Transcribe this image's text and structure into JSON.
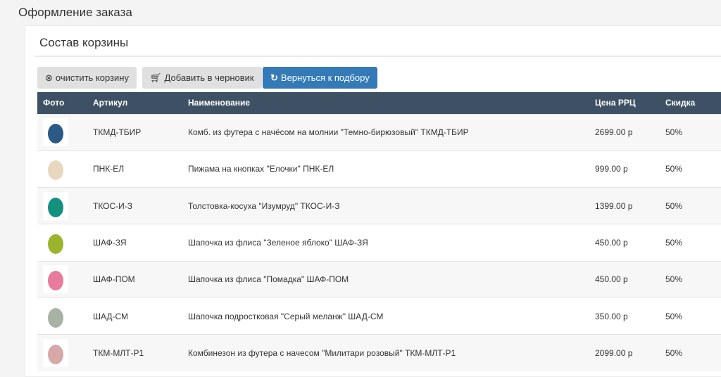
{
  "page_title": "Оформление заказа",
  "card_title": "Состав корзины",
  "buttons": {
    "clear": "очистить корзину",
    "draft": "Добавить в черновик",
    "back": "Вернуться к подбору"
  },
  "columns": [
    "Фото",
    "Артикул",
    "Наименование",
    "Цена РРЦ",
    "Скидка"
  ],
  "rows": [
    {
      "sku": "ТКМД-ТБИР",
      "name": "Комб. из футера с начёсом на молнии \"Темно-бирюзовый\" ТКМД-ТБИР",
      "price": "2699.00 р",
      "discount": "50%",
      "color": "#2a5a85"
    },
    {
      "sku": "ПНК-ЕЛ",
      "name": "Пижама на кнопках \"Елочки\" ПНК-ЕЛ",
      "price": "999.00 р",
      "discount": "50%",
      "color": "#e8d8c0"
    },
    {
      "sku": "ТКОС-И-З",
      "name": "Толстовка-косуха \"Изумруд\" ТКОС-И-З",
      "price": "1399.00 р",
      "discount": "50%",
      "color": "#14907f"
    },
    {
      "sku": "ШАФ-ЗЯ",
      "name": "Шапочка из флиса \"Зеленое яблоко\" ШАФ-ЗЯ",
      "price": "450.00 р",
      "discount": "50%",
      "color": "#9ab52c"
    },
    {
      "sku": "ШАФ-ПОМ",
      "name": "Шапочка из флиса \"Помадка\" ШАФ-ПОМ",
      "price": "450.00 р",
      "discount": "50%",
      "color": "#e87c9c"
    },
    {
      "sku": "ШАД-СМ",
      "name": "Шапочка подростковая \"Серый меланж\" ШАД-СМ",
      "price": "350.00 р",
      "discount": "50%",
      "color": "#a9b3a4"
    },
    {
      "sku": "ТКМ-МЛТ-Р1",
      "name": "Комбинезон из футера с начесом \"Милитари розовый\" ТКМ-МЛТ-Р1",
      "price": "2099.00 р",
      "discount": "50%",
      "color": "#d8a8a8"
    }
  ]
}
